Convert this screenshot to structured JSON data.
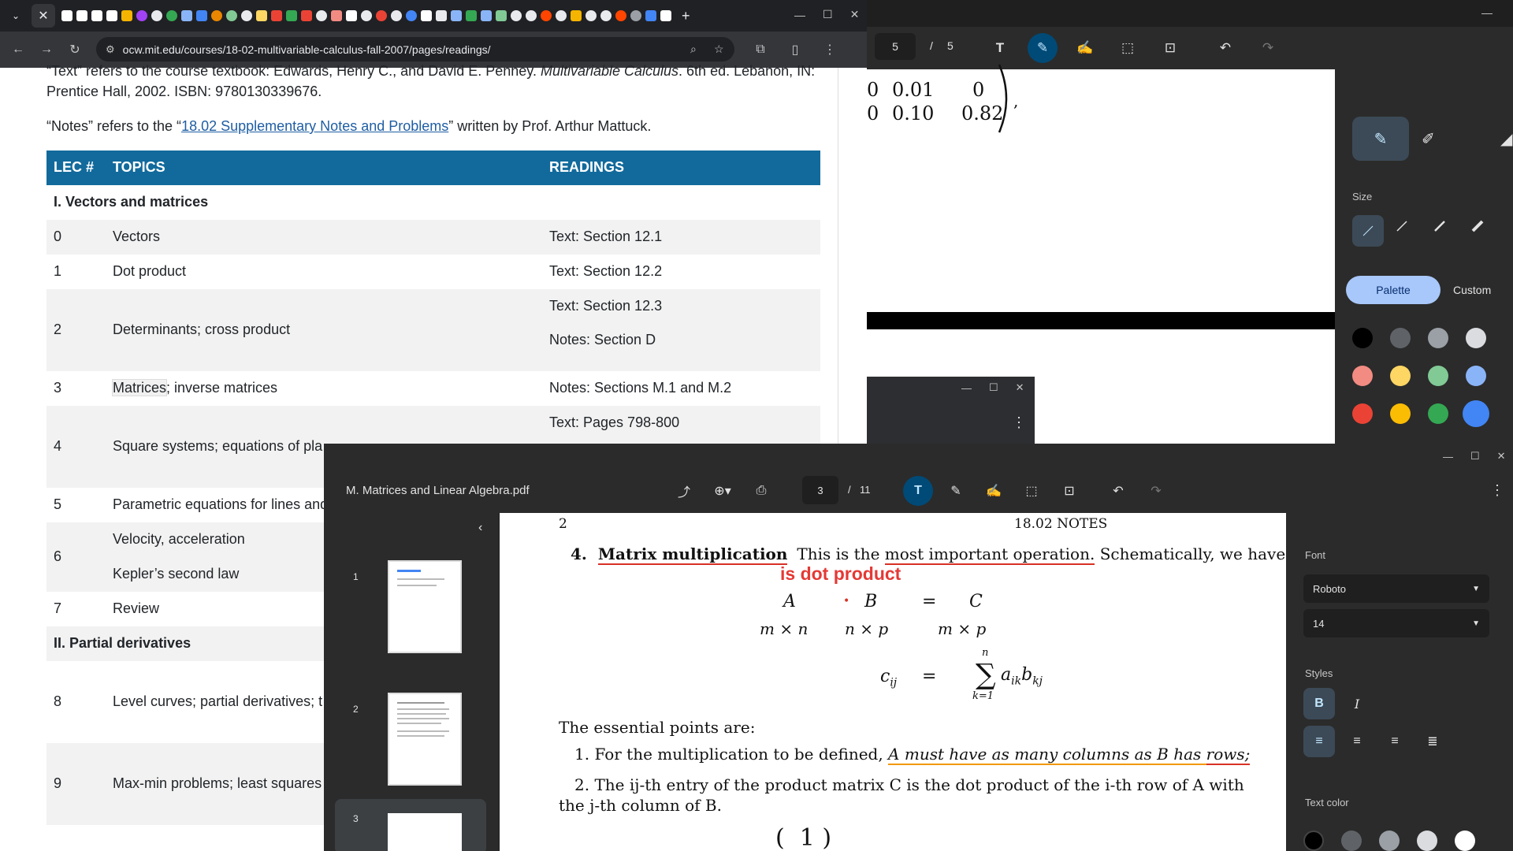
{
  "browser": {
    "address": "ocw.mit.edu/courses/18-02-multivariable-calculus-fall-2007/pages/readings/",
    "intro_text_1": "“Text” refers to the course textbook: Edwards, Henry C., and David E. Penney.",
    "intro_text_1_em": "Multivariable Calculus",
    "intro_text_1_tail": ". 6th ed. Lebanon, IN:",
    "intro_text_2": "Prentice Hall, 2002. ISBN: 9780130339676.",
    "notes_prefix": "“Notes” refers to the “",
    "notes_link": "18.02 Supplementary Notes and Problems",
    "notes_suffix": "” written by Prof. Arthur Mattuck.",
    "table": {
      "headers": [
        "LEC #",
        "TOPICS",
        "READINGS"
      ],
      "section1": "I. Vectors and matrices",
      "section2": "II. Partial derivatives",
      "rows": [
        {
          "num": "0",
          "topic": "Vectors",
          "reading": "Text: Section 12.1"
        },
        {
          "num": "1",
          "topic": "Dot product",
          "reading": "Text: Section 12.2"
        },
        {
          "num": "2",
          "topic": "Determinants; cross product",
          "reading": "Text: Section 12.3",
          "reading2": "Notes: Section D"
        },
        {
          "num": "3",
          "topic_hl": "Matrices",
          "topic": "; inverse matrices",
          "reading": "Notes: Sections M.1 and M.2"
        },
        {
          "num": "4",
          "topic": "Square systems; equations of pla",
          "reading": "Text: Pages 798-800"
        },
        {
          "num": "5",
          "topic": "Parametric equations for lines and"
        },
        {
          "num": "6",
          "topic": "Velocity, acceleration",
          "topic2": "Kepler’s second law"
        },
        {
          "num": "7",
          "topic": "Review"
        },
        {
          "num": "8",
          "topic": "Level curves; partial derivatives; t"
        },
        {
          "num": "9",
          "topic": "Max-min problems; least squares"
        }
      ]
    }
  },
  "pdf_back": {
    "page_current": "5",
    "page_sep": "/",
    "page_total": "5",
    "matrix_r1": [
      "0.01",
      "0"
    ],
    "matrix_r2": [
      "0.10",
      "0.82"
    ],
    "matrix_lead": [
      "0",
      "0"
    ],
    "size_label": "Size",
    "tab_palette": "Palette",
    "tab_custom": "Custom",
    "swatches": [
      "#000000",
      "#5f6368",
      "#9aa0a6",
      "#dadce0",
      "#f28b82",
      "#fdd663",
      "#81c995",
      "#8ab4f8",
      "#ea4335",
      "#fbbc04",
      "#34a853",
      "#4285f4"
    ]
  },
  "pdf_front": {
    "title": "M. Matrices and Linear Algebra.pdf",
    "page_current": "3",
    "page_sep": "/",
    "page_total": "11",
    "thumb_labels": [
      "1",
      "2",
      "3"
    ],
    "header_page": "2",
    "header_title": "18.02 NOTES",
    "section_num": "4.",
    "section_title": "Matrix multiplication",
    "section_text_a": "This is the ",
    "section_text_b": "most important operation.",
    "section_text_c": " Schematically, we have",
    "annotation": "is dot product",
    "eq_A": "A",
    "eq_dot": "•",
    "eq_B": "B",
    "eq_eq": "=",
    "eq_C": "C",
    "eq_dimA": "m × n",
    "eq_dimB": "n × p",
    "eq_dimC": "m × p",
    "eq_cij": "c",
    "eq_cij_sub": "ij",
    "eq_sum_top": "n",
    "eq_sum_bot": "k=1",
    "eq_sum_body": "a",
    "eq_sum_sub1": "ik",
    "eq_sum_b": "b",
    "eq_sum_sub2": "kj",
    "essential": "The essential points are:",
    "point1_a": "1.  For the multiplication to be defined, ",
    "point1_b": "A must have as many ",
    "point1_c": "columns",
    "point1_d": " as B has ",
    "point1_e": "rows;",
    "point2_a": "2.  The ij-th entry of the product matrix C is the dot product of the i-th row of A with",
    "point2_b": "the j-th column of B.",
    "font_label": "Font",
    "font_value": "Roboto",
    "size_value": "14",
    "styles_label": "Styles",
    "bold": "B",
    "italic": "I",
    "text_color_label": "Text color"
  }
}
